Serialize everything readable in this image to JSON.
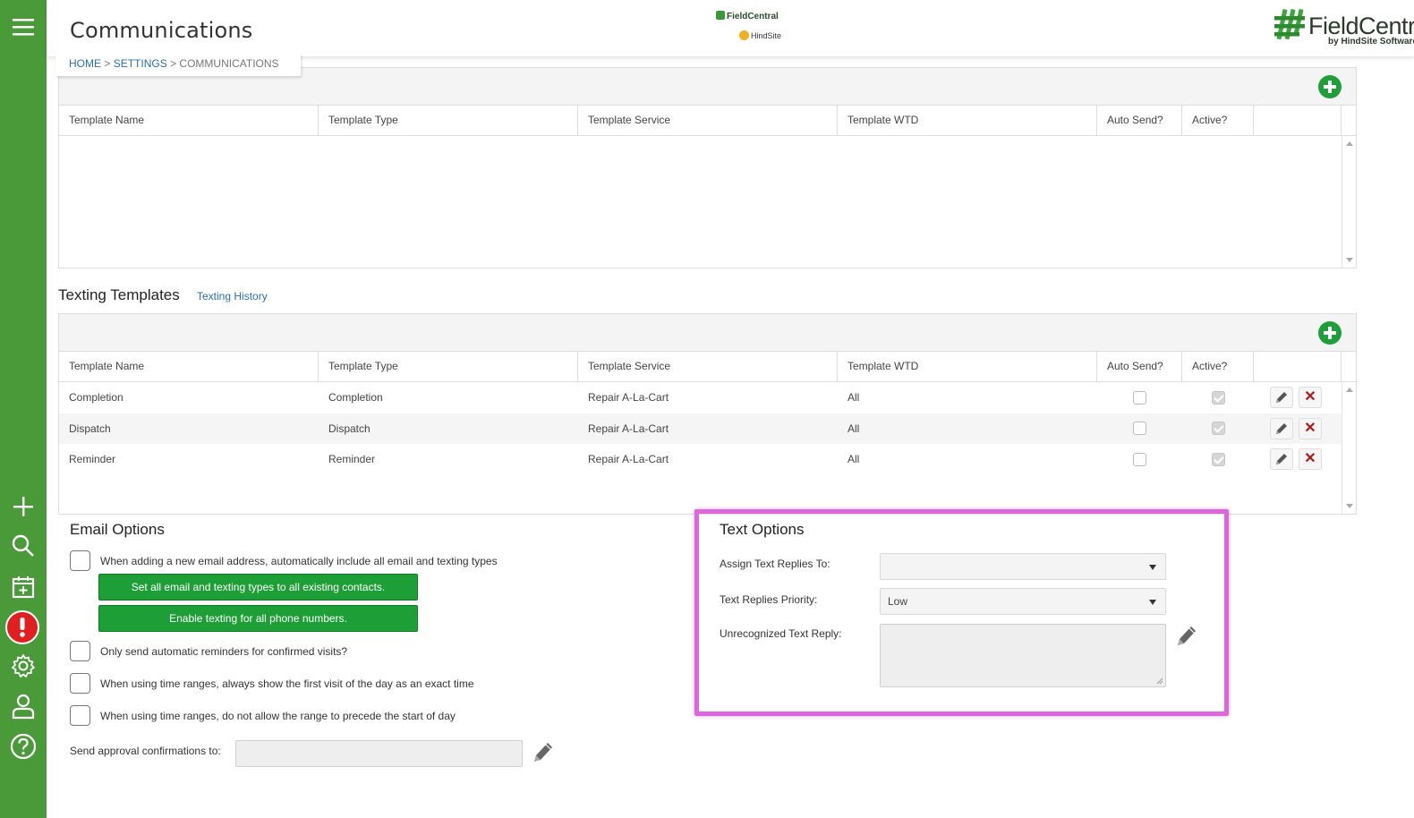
{
  "header": {
    "title": "Communications",
    "breadcrumb": {
      "home": "HOME",
      "settings": "SETTINGS",
      "current": "COMMUNICATIONS",
      "sep": ">"
    },
    "mini_logo": {
      "line1": "FieldCentral",
      "line2": "HindSite"
    },
    "brand": {
      "name": "FieldCentral",
      "sub": "by HindSite Software"
    }
  },
  "columns": [
    "Template Name",
    "Template Type",
    "Template Service",
    "Template WTD",
    "Auto Send?",
    "Active?"
  ],
  "texting": {
    "title": "Texting Templates",
    "history_link": "Texting History",
    "rows": [
      {
        "name": "Completion",
        "type": "Completion",
        "service": "Repair A-La-Cart",
        "wtd": "All"
      },
      {
        "name": "Dispatch",
        "type": "Dispatch",
        "service": "Repair A-La-Cart",
        "wtd": "All"
      },
      {
        "name": "Reminder",
        "type": "Reminder",
        "service": "Repair A-La-Cart",
        "wtd": "All"
      }
    ]
  },
  "email_options": {
    "title": "Email Options",
    "opt1": "When adding a new email address, automatically include all email and texting types",
    "btn_set_all": "Set all email and texting types to all existing contacts.",
    "btn_enable_texting": "Enable texting for all phone numbers.",
    "opt2": "Only send automatic reminders for confirmed visits?",
    "opt3": "When using time ranges, always show the first visit of the day as an exact time",
    "opt4": "When using time ranges, do not allow the range to precede the start of day",
    "approval_label": "Send approval confirmations to:"
  },
  "text_options": {
    "title": "Text Options",
    "assign_label": "Assign Text Replies To:",
    "assign_value": "",
    "priority_label": "Text Replies Priority:",
    "priority_value": "Low",
    "unrecognized_label": "Unrecognized Text Reply:"
  },
  "colors": {
    "sidebar": "#4a9a3a",
    "accent_green": "#1e9e36",
    "highlight": "#dd66dd",
    "link": "#2a6fb0"
  }
}
